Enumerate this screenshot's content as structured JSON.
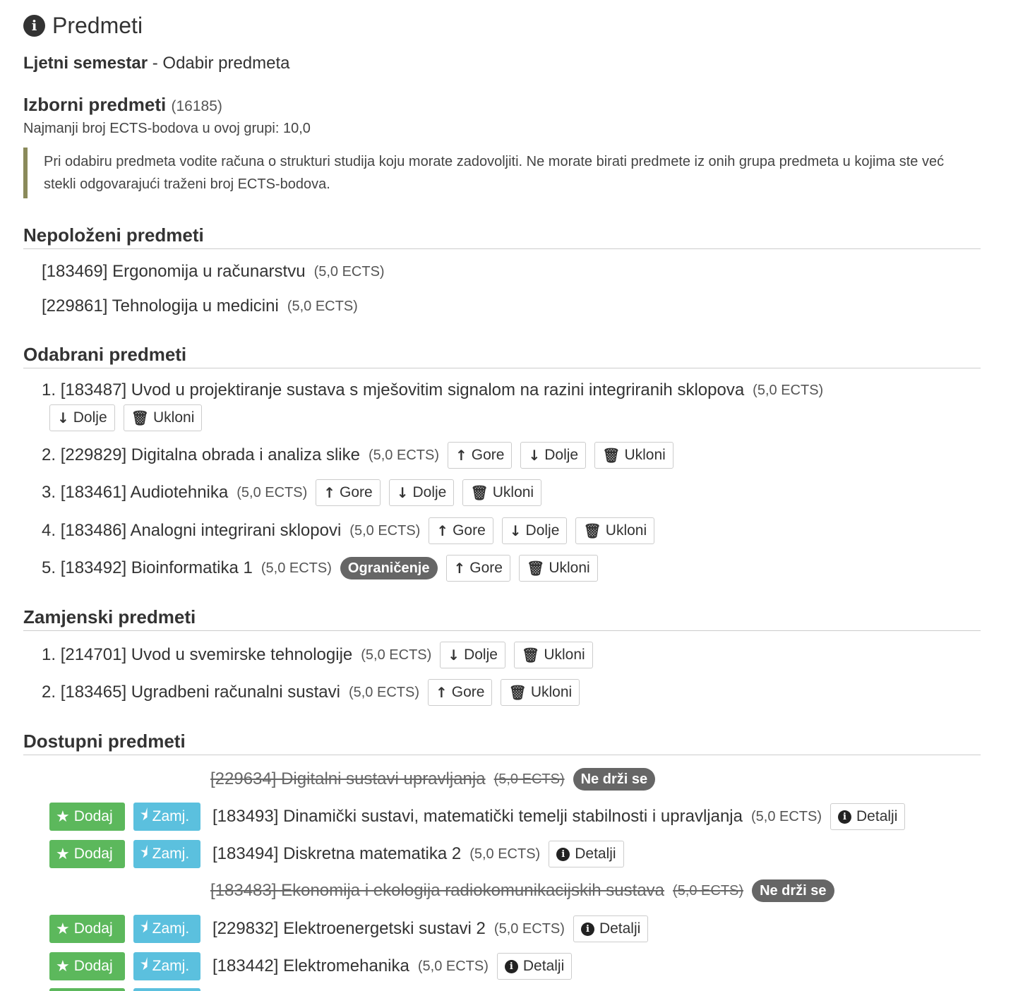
{
  "header": {
    "title": "Predmeti",
    "icon": "info-icon"
  },
  "semester": {
    "bold": "Ljetni semestar",
    "rest": " - Odabir predmeta"
  },
  "group": {
    "name": "Izborni predmeti",
    "id": "(16185)",
    "min_ects": "Najmanji broj ECTS-bodova u ovoj grupi: 10,0"
  },
  "note": "Pri odabiru predmeta vodite računa o strukturi studija koju morate zadovoljiti. Ne morate birati predmete iz onih grupa predmeta u kojima ste već stekli odgovarajući traženi broj ECTS-bodova.",
  "labels": {
    "up": "Gore",
    "down": "Dolje",
    "remove": "Ukloni",
    "add": "Dodaj",
    "replace": "Zamj.",
    "details": "Detalji",
    "restriction": "Ograničenje",
    "not_held": "Ne drži se"
  },
  "sections": {
    "unpassed": "Nepoloženi predmeti",
    "selected": "Odabrani predmeti",
    "replacement": "Zamjenski predmeti",
    "available": "Dostupni predmeti"
  },
  "unpassed": [
    {
      "name": "[183469] Ergonomija u računarstvu",
      "ects": "(5,0 ECTS)"
    },
    {
      "name": "[229861] Tehnologija u medicini",
      "ects": "(5,0 ECTS)"
    }
  ],
  "selected": [
    {
      "num": "1.",
      "name": "[183487] Uvod u projektiranje sustava s mješovitim signalom na razini integriranih sklopova",
      "ects": "(5,0 ECTS)"
    },
    {
      "num": "2.",
      "name": "[229829] Digitalna obrada i analiza slike",
      "ects": "(5,0 ECTS)"
    },
    {
      "num": "3.",
      "name": "[183461] Audiotehnika",
      "ects": "(5,0 ECTS)"
    },
    {
      "num": "4.",
      "name": "[183486] Analogni integrirani sklopovi",
      "ects": "(5,0 ECTS)"
    },
    {
      "num": "5.",
      "name": "[183492] Bioinformatika 1",
      "ects": "(5,0 ECTS)"
    }
  ],
  "replacement": [
    {
      "num": "1.",
      "name": "[214701] Uvod u svemirske tehnologije",
      "ects": "(5,0 ECTS)"
    },
    {
      "num": "2.",
      "name": "[183465] Ugradbeni računalni sustavi",
      "ects": "(5,0 ECTS)"
    }
  ],
  "available": [
    {
      "name": "[229634] Digitalni sustavi upravljanja",
      "ects": "(5,0 ECTS)"
    },
    {
      "name": "[183493] Dinamički sustavi, matematički temelji stabilnosti i upravljanja",
      "ects": "(5,0 ECTS)"
    },
    {
      "name": "[183494] Diskretna matematika 2",
      "ects": "(5,0 ECTS)"
    },
    {
      "name": "[183483] Ekonomija i ekologija radiokomunikacijskih sustava",
      "ects": "(5,0 ECTS)"
    },
    {
      "name": "[229832] Elektroenergetski sustavi 2",
      "ects": "(5,0 ECTS)"
    },
    {
      "name": "[183442] Elektromehanika",
      "ects": "(5,0 ECTS)"
    }
  ]
}
